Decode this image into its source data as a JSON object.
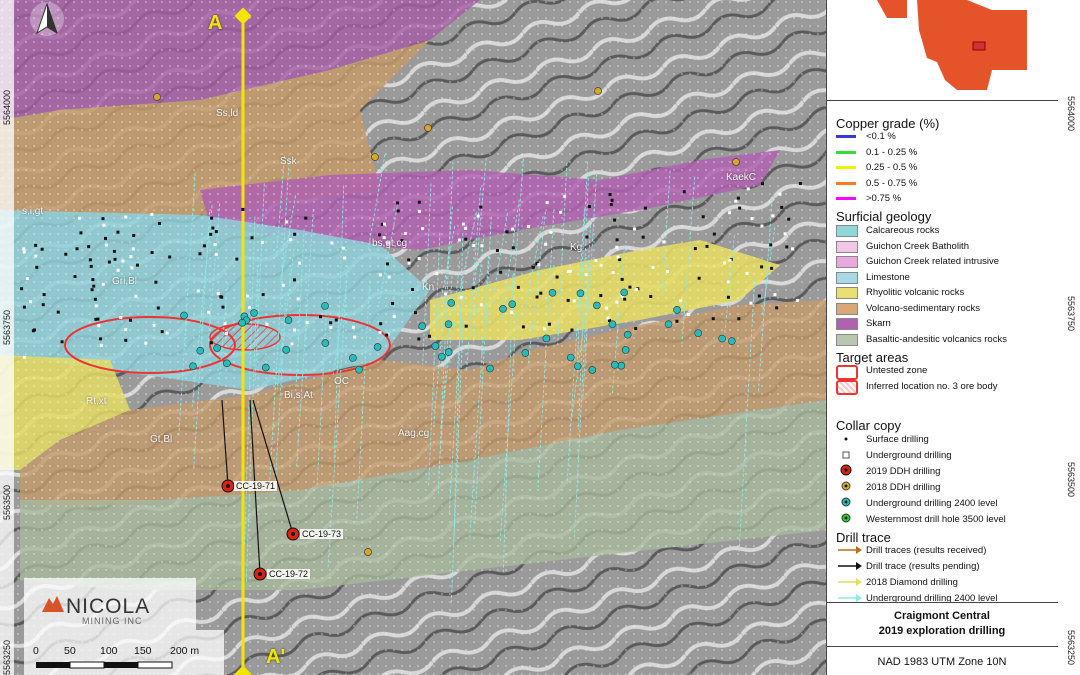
{
  "map": {
    "section_start": "A",
    "section_end": "A'",
    "north_arrow": "north-arrow-icon",
    "geology_labels": [
      "Ss,ld",
      "Ssk",
      "s,i,gt",
      "bs,gt,cg",
      "Kg",
      "KaekC",
      "Gri,Bl",
      "Kn",
      "Rt,xt",
      "Gt,Bl",
      "Bi,s,At",
      "OC",
      "Aag,cg"
    ],
    "hole_labels": [
      "CC-19-71",
      "CC-19-73",
      "CC-19-72"
    ]
  },
  "coords": {
    "left": [
      "5564000",
      "5563750",
      "5563500",
      "5563250"
    ],
    "right": [
      "5564000",
      "5563750",
      "5563500",
      "5563250"
    ]
  },
  "legend": {
    "copper_title": "Copper grade (%)",
    "copper_items": [
      {
        "label": "<0.1 %",
        "color": "#3a3ad8"
      },
      {
        "label": "0.1 - 0.25 %",
        "color": "#33dd33"
      },
      {
        "label": "0.25 - 0.5 %",
        "color": "#f0f000"
      },
      {
        "label": "0.5 - 0.75 %",
        "color": "#ff7a1a"
      },
      {
        "label": ">0.75 %",
        "color": "#ff00ff"
      }
    ],
    "geology_title": "Surficial geology",
    "geology_items": [
      {
        "label": "Calcareous rocks",
        "color": "#8fd8d8"
      },
      {
        "label": "Guichon Creek Batholith",
        "color": "#f3c6e8"
      },
      {
        "label": "Guichon Creek related intrusive",
        "color": "#e8a8e0"
      },
      {
        "label": "Limestone",
        "color": "#a8d8e8"
      },
      {
        "label": "Rhyolitic volcanic rocks",
        "color": "#e8e070"
      },
      {
        "label": "Volcano-sedimentary rocks",
        "color": "#d9a878"
      },
      {
        "label": "Skarn",
        "color": "#b062b0"
      },
      {
        "label": "Basaltic-andesitic volcanics rocks",
        "color": "#b8c8b0"
      }
    ],
    "target_title": "Target areas",
    "target_items": [
      "Untested zone",
      "Inferred location no. 3 ore body"
    ],
    "collar_title": "Collar copy",
    "collar_items": [
      "Surface drilling",
      "Underground drilling",
      "2019 DDH drilling",
      "2018 DDH drilling",
      "Underground drilling 2400  level",
      "Westernmost drill hole 3500 level"
    ],
    "trace_title": "Drill trace",
    "trace_items": [
      "Drill traces (results received)",
      "Drill trace (results pending)",
      "2018 Diamond drilling",
      "Underground drilling 2400 level"
    ]
  },
  "title_block": {
    "line1": "Craigmont Central",
    "line2": "2019 exploration drilling",
    "datum": "NAD 1983 UTM Zone 10N"
  },
  "logo": {
    "name": "NICOLA",
    "sub": "MINING INC"
  },
  "scale": {
    "ticks": [
      "0",
      "50",
      "100",
      "150",
      "200 m"
    ]
  }
}
